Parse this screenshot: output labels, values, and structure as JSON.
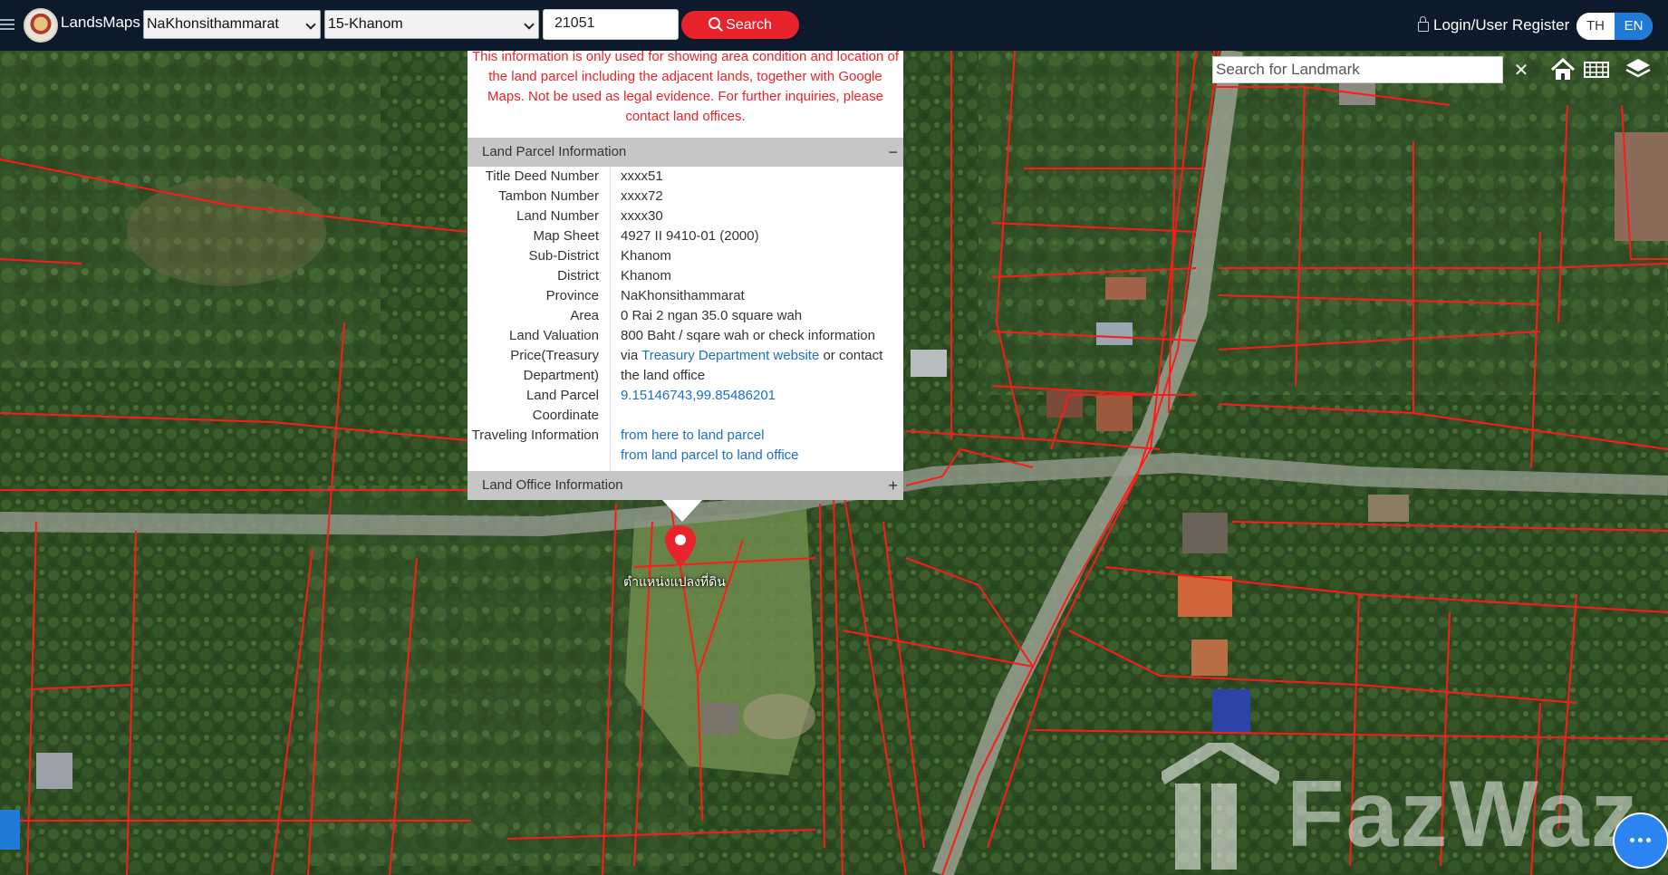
{
  "header": {
    "brand": "LandsMaps",
    "province_select": "NaKhonsithammarat",
    "district_select": "15-Khanom",
    "parcel_number": "21051",
    "search_label": "Search",
    "login_label": "Login/User Register",
    "lang_th": "TH",
    "lang_en": "EN"
  },
  "map_controls": {
    "landmark_placeholder": "Search for Landmark",
    "close": "✕"
  },
  "popup": {
    "disclaimer": "This information is only used for showing area condition and location of the land parcel including the adjacent lands, together with Google Maps. Not be used as legal evidence. For further inquiries, please contact land offices.",
    "section_title": "Land Parcel Information",
    "collapse_sign": "−",
    "rows": {
      "title_deed_label": "Title Deed Number",
      "title_deed_value": "xxxx51",
      "tambon_label": "Tambon Number",
      "tambon_value": "xxxx72",
      "land_label": "Land Number",
      "land_value": "xxxx30",
      "map_sheet_label": "Map Sheet",
      "map_sheet_value": "4927 II 9410-01 (2000)",
      "subdistrict_label": "Sub-District",
      "subdistrict_value": "Khanom",
      "district_label": "District",
      "district_value": "Khanom",
      "province_label": "Province",
      "province_value": "NaKhonsithammarat",
      "area_label": "Area",
      "area_value": "0 Rai 2 ngan 35.0 square wah",
      "valuation_label_1": "Land Valuation",
      "valuation_label_2": "Price(Treasury",
      "valuation_label_3": "Department)",
      "valuation_value_1": "800 Baht / sqare wah or check information",
      "valuation_value_2a": "via",
      "valuation_link": "Treasury Department website",
      "valuation_value_2b": "or contact",
      "valuation_value_3": "the land office",
      "coord_label_1": "Land Parcel",
      "coord_label_2": "Coordinate",
      "coord_value": "9.15146743,99.85486201",
      "travel_label": "Traveling Information",
      "travel_link_1": "from here to land parcel",
      "travel_link_2": "from land parcel to land office"
    },
    "office_section_title": "Land Office Information",
    "expand_sign": "+"
  },
  "marker_label": "ตำแหน่งแปลงที่ดิน",
  "watermark": "FazWaz",
  "colors": {
    "topbar": "#0c1a2c",
    "accent_red": "#e8232b",
    "parcel_lines": "#ff1a1a",
    "link_blue": "#1a6fc8",
    "lang_active": "#1f7ad8"
  }
}
